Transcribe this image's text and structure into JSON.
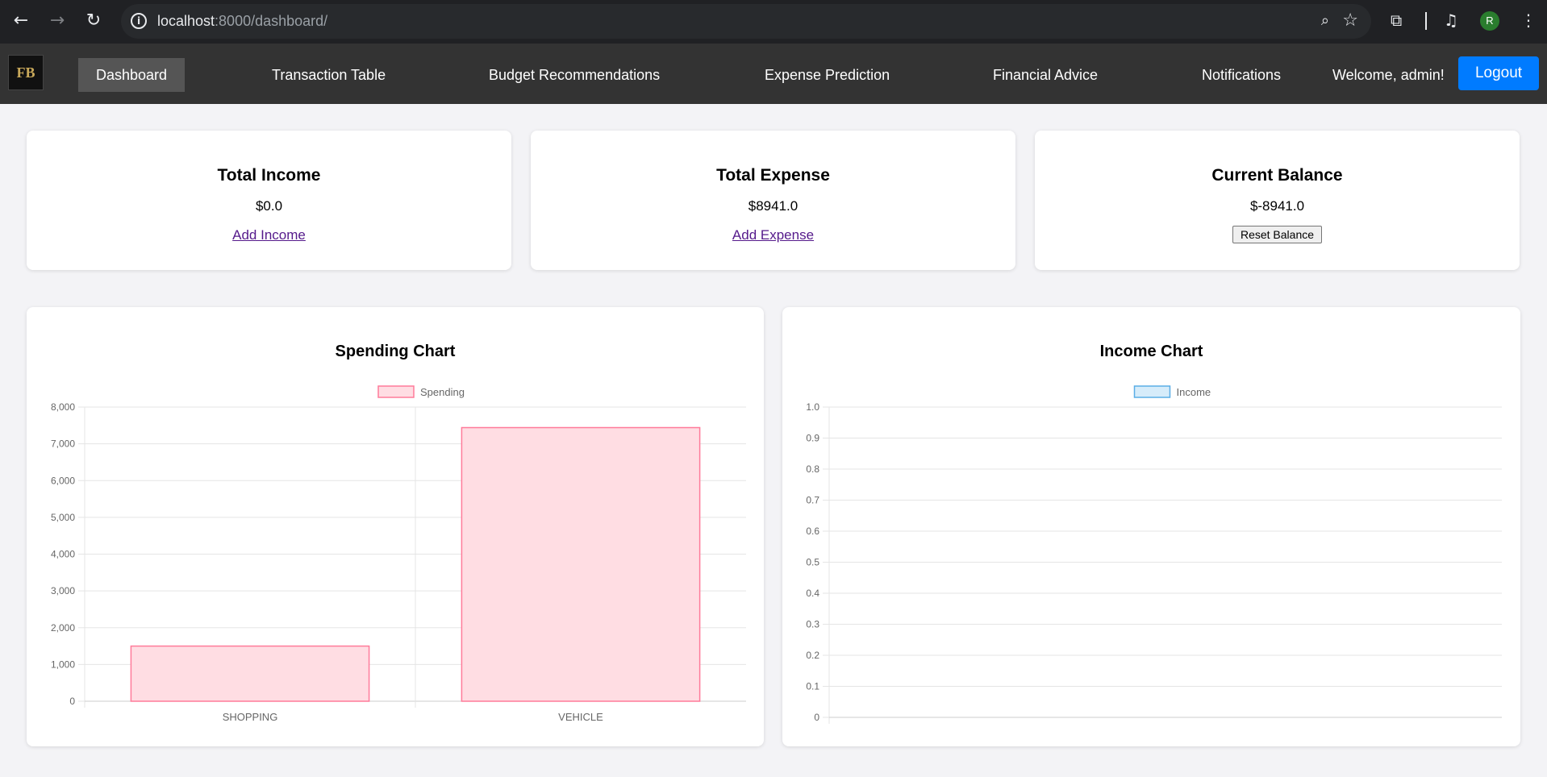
{
  "browser": {
    "url_host": "localhost",
    "url_path": ":8000/dashboard/",
    "profile_initial": "R"
  },
  "nav": {
    "logo_text": "FB",
    "items": [
      {
        "label": "Dashboard",
        "active": true
      },
      {
        "label": "Transaction Table"
      },
      {
        "label": "Budget Recommendations"
      },
      {
        "label": "Expense Prediction"
      },
      {
        "label": "Financial Advice"
      },
      {
        "label": "Notifications"
      }
    ],
    "welcome": "Welcome, admin!",
    "logout_label": "Logout"
  },
  "summary": {
    "income": {
      "title": "Total Income",
      "amount": "$0.0",
      "link": "Add Income"
    },
    "expense": {
      "title": "Total Expense",
      "amount": "$8941.0",
      "link": "Add Expense"
    },
    "balance": {
      "title": "Current Balance",
      "amount": "$-8941.0",
      "button": "Reset Balance"
    }
  },
  "charts": {
    "spending_title": "Spending Chart",
    "income_title": "Income Chart"
  },
  "chart_data": [
    {
      "type": "bar",
      "title": "Spending Chart",
      "categories": [
        "SHOPPING",
        "VEHICLE"
      ],
      "series": [
        {
          "name": "Spending",
          "values": [
            1500,
            7441
          ]
        }
      ],
      "ylim": [
        0,
        8000
      ],
      "yticks": [
        "0",
        "1,000",
        "2,000",
        "3,000",
        "4,000",
        "5,000",
        "6,000",
        "7,000",
        "8,000"
      ],
      "grid": true,
      "legend": "top-center",
      "colors": {
        "fill": "#ffdde3",
        "stroke": "#ff7b9a"
      }
    },
    {
      "type": "bar",
      "title": "Income Chart",
      "categories": [],
      "series": [
        {
          "name": "Income",
          "values": []
        }
      ],
      "ylim": [
        0,
        1
      ],
      "yticks": [
        "0",
        "0.1",
        "0.2",
        "0.3",
        "0.4",
        "0.5",
        "0.6",
        "0.7",
        "0.8",
        "0.9",
        "1.0"
      ],
      "grid": true,
      "legend": "top-center",
      "colors": {
        "fill": "#d6ecfa",
        "stroke": "#5aaee6"
      }
    }
  ]
}
